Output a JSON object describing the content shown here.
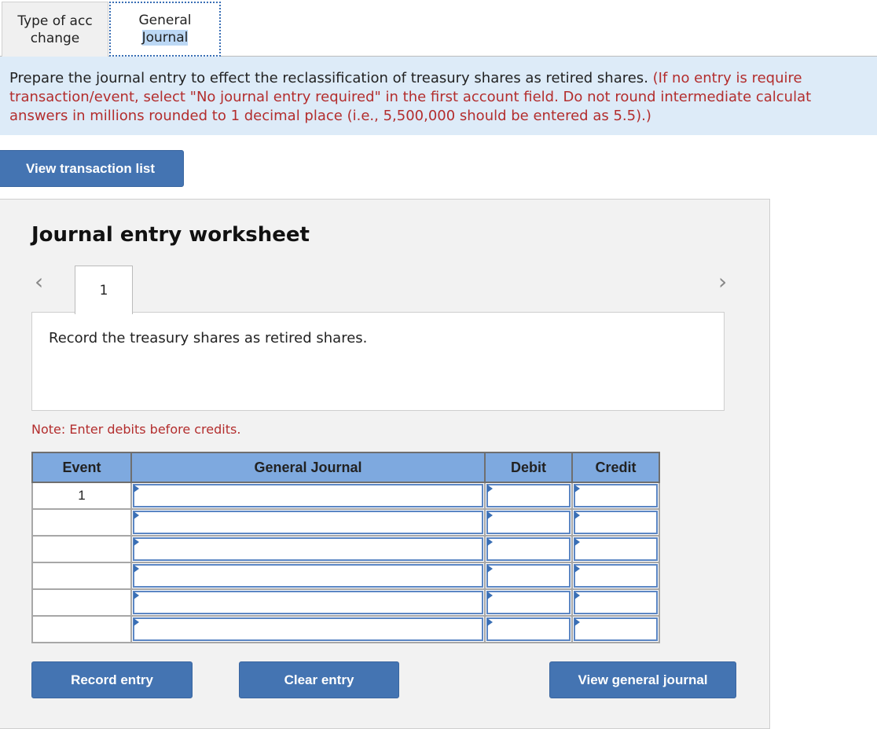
{
  "tabs": [
    {
      "line1": "Type of acc",
      "line2": "change",
      "active": false
    },
    {
      "line1": "General",
      "line2": "Journal",
      "active": true
    }
  ],
  "instructions": {
    "main": "Prepare the journal entry to effect the reclassification of treasury shares as retired shares.",
    "note_line1": " (If no entry is require",
    "note_line2": "transaction/event, select \"No journal entry required\" in the first account field. Do not round intermediate calculat",
    "note_line3": "answers in millions rounded to 1 decimal place (i.e., 5,500,000 should be entered as 5.5).)"
  },
  "buttons": {
    "view_transaction_list": "View transaction list",
    "record_entry": "Record entry",
    "clear_entry": "Clear entry",
    "view_general_journal": "View general journal"
  },
  "worksheet": {
    "title": "Journal entry worksheet",
    "prev_icon": "‹",
    "next_icon": "›",
    "current_event": "1",
    "description": "Record the treasury shares as retired shares.",
    "note": "Note: Enter debits before credits.",
    "table": {
      "headers": [
        "Event",
        "General Journal",
        "Debit",
        "Credit"
      ],
      "rows": [
        {
          "event": "1",
          "account": "",
          "debit": "",
          "credit": ""
        },
        {
          "event": "",
          "account": "",
          "debit": "",
          "credit": ""
        },
        {
          "event": "",
          "account": "",
          "debit": "",
          "credit": ""
        },
        {
          "event": "",
          "account": "",
          "debit": "",
          "credit": ""
        },
        {
          "event": "",
          "account": "",
          "debit": "",
          "credit": ""
        },
        {
          "event": "",
          "account": "",
          "debit": "",
          "credit": ""
        }
      ]
    }
  },
  "colors": {
    "accent": "#4474b2",
    "header_blue": "#7ea9df",
    "instruction_bg": "#ddebf8",
    "note_red": "#b32d2d"
  }
}
